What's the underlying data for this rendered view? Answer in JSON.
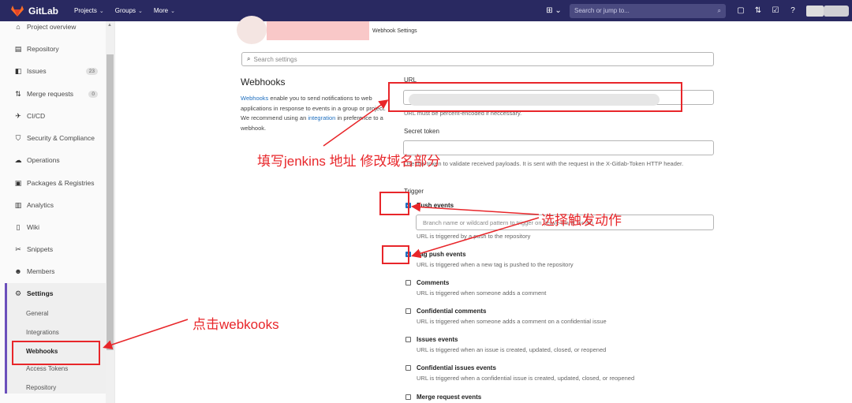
{
  "topbar": {
    "brand": "GitLab",
    "nav": [
      {
        "label": "Projects"
      },
      {
        "label": "Groups"
      },
      {
        "label": "More"
      }
    ],
    "search_placeholder": "Search or jump to..."
  },
  "sidebar": {
    "items": [
      {
        "label": "Project overview",
        "icon": "home-icon"
      },
      {
        "label": "Repository",
        "icon": "file-icon"
      },
      {
        "label": "Issues",
        "icon": "issues-icon",
        "count": "23"
      },
      {
        "label": "Merge requests",
        "icon": "merge-request-icon",
        "count": "0"
      },
      {
        "label": "CI/CD",
        "icon": "rocket-icon"
      },
      {
        "label": "Security & Compliance",
        "icon": "shield-icon"
      },
      {
        "label": "Operations",
        "icon": "cloud-icon"
      },
      {
        "label": "Packages & Registries",
        "icon": "package-icon"
      },
      {
        "label": "Analytics",
        "icon": "chart-icon"
      },
      {
        "label": "Wiki",
        "icon": "book-icon"
      },
      {
        "label": "Snippets",
        "icon": "scissors-icon"
      },
      {
        "label": "Members",
        "icon": "users-icon"
      },
      {
        "label": "Settings",
        "icon": "gear-icon"
      }
    ],
    "settings_sub": [
      {
        "label": "General"
      },
      {
        "label": "Integrations"
      },
      {
        "label": "Webhooks"
      },
      {
        "label": "Access Tokens"
      },
      {
        "label": "Repository"
      }
    ]
  },
  "main": {
    "breadcrumb_current": "Webhook Settings",
    "search_placeholder": "Search settings",
    "section_title": "Webhooks",
    "desc_link": "Webhooks",
    "desc_text_1": " enable you to send notifications to web applications in response to events in a group or project. We recommend using an ",
    "desc_link2": "integration",
    "desc_text_2": " in preference to a webhook.",
    "url_label": "URL",
    "url_help": "URL must be percent-encoded if neccessary.",
    "secret_label": "Secret token",
    "secret_help": "Use this token to validate received payloads. It is sent with the request in the X-Gitlab-Token HTTP header.",
    "trigger_label": "Trigger",
    "branch_placeholder": "Branch name or wildcard pattern to trigger on (leave blank for all)",
    "triggers": [
      {
        "title": "Push events",
        "desc": "URL is triggered by a push to the repository",
        "checked": true
      },
      {
        "title": "Tag push events",
        "desc": "URL is triggered when a new tag is pushed to the repository",
        "checked": true
      },
      {
        "title": "Comments",
        "desc": "URL is triggered when someone adds a comment",
        "checked": false
      },
      {
        "title": "Confidential comments",
        "desc": "URL is triggered when someone adds a comment on a confidential issue",
        "checked": false
      },
      {
        "title": "Issues events",
        "desc": "URL is triggered when an issue is created, updated, closed, or reopened",
        "checked": false
      },
      {
        "title": "Confidential issues events",
        "desc": "URL is triggered when a confidential issue is created, updated, closed, or reopened",
        "checked": false
      },
      {
        "title": "Merge request events",
        "desc": "",
        "checked": false
      }
    ]
  },
  "annotations": {
    "url_note": "填写jenkins 地址 修改域名部分",
    "trigger_note": "选择触发动作",
    "webhooks_note": "点击webkooks",
    "color": "#e8262a"
  }
}
